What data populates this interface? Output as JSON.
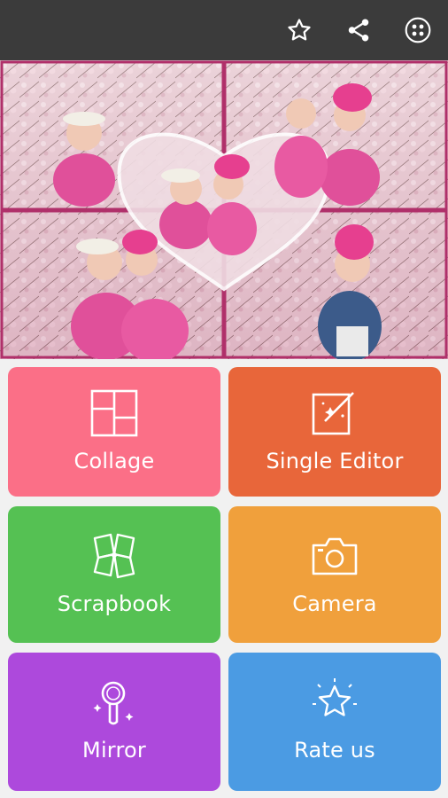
{
  "topbar": {
    "icons": [
      "star-outline-icon",
      "share-icon",
      "more-apps-icon"
    ]
  },
  "hero": {
    "description_icon": "collage-preview-image"
  },
  "tiles": [
    {
      "label": "Collage",
      "icon": "collage-grid-icon",
      "color": "#fb6f87"
    },
    {
      "label": "Single Editor",
      "icon": "magic-edit-icon",
      "color": "#e8663a"
    },
    {
      "label": "Scrapbook",
      "icon": "scrapbook-icon",
      "color": "#55c153"
    },
    {
      "label": "Camera",
      "icon": "camera-icon",
      "color": "#f0a03c"
    },
    {
      "label": "Mirror",
      "icon": "hand-mirror-icon",
      "color": "#ad49dc"
    },
    {
      "label": "Rate us",
      "icon": "star-sparkle-icon",
      "color": "#4b9be3"
    }
  ],
  "colors": {
    "topbar": "#3b3b3b",
    "background": "#f1f1f1"
  }
}
